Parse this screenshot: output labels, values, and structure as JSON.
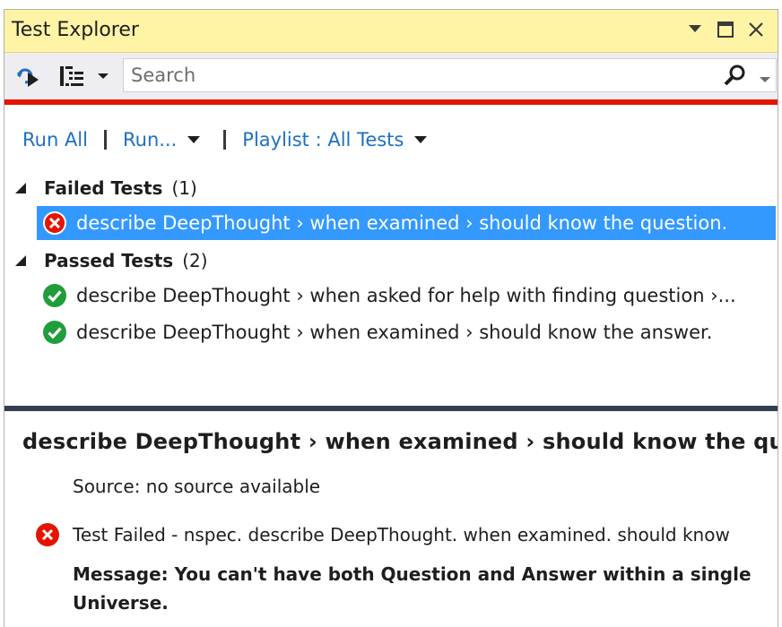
{
  "window": {
    "title": "Test Explorer",
    "pin_icon": "dropdown-arrow-icon",
    "maximize_icon": "maximize-icon",
    "close_icon": "close-icon"
  },
  "toolbar": {
    "debug_icon": "run-debug-icon",
    "group_icon": "group-by-icon",
    "search_placeholder": "Search",
    "search_icon": "search-icon"
  },
  "commands": {
    "run_all": "Run All",
    "run": "Run...",
    "playlist": "Playlist : All Tests"
  },
  "groups": {
    "failed": {
      "name": "Failed Tests",
      "count": "(1)"
    },
    "passed": {
      "name": "Passed Tests",
      "count": "(2)"
    }
  },
  "tests": {
    "failed": [
      {
        "label": "describe DeepThought › when examined › should know the question.",
        "status": "failed"
      }
    ],
    "passed": [
      {
        "label": "describe DeepThought › when asked for help with finding question ›...",
        "status": "passed"
      },
      {
        "label": "describe DeepThought › when examined › should know the answer.",
        "status": "passed"
      }
    ]
  },
  "detail": {
    "title": "describe DeepThought › when examined › should know the questio",
    "source": "Source: no source available",
    "result": "Test Failed - nspec. describe DeepThought. when examined. should know",
    "message": "Message: You can't have both Question and Answer within a single Universe."
  },
  "colors": {
    "title_bar": "#fff4a6",
    "toolbar": "#eeeef2",
    "failure_bar": "#e51400",
    "selection": "#3399ff",
    "link": "#1e6fc2",
    "fail_icon": "#e51400",
    "pass_icon": "#1f9e3a"
  }
}
